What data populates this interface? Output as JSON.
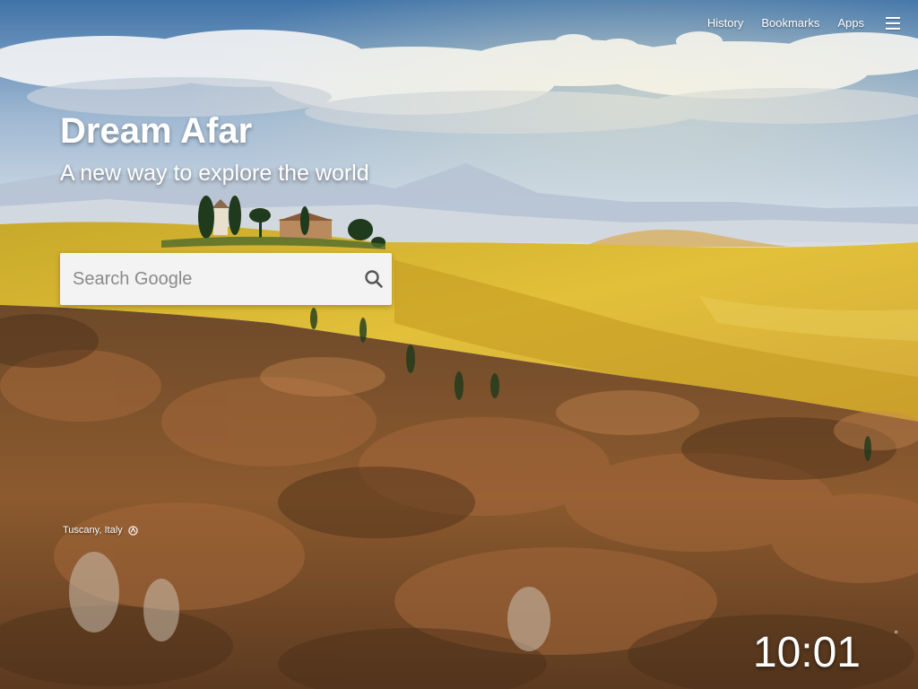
{
  "nav": {
    "history": "History",
    "bookmarks": "Bookmarks",
    "apps": "Apps",
    "menu_icon": "hamburger-menu-icon"
  },
  "brand": {
    "title": "Dream Afar",
    "subtitle": "A new way to explore the world"
  },
  "search": {
    "placeholder": "Search Google",
    "value": "",
    "icon": "search-icon"
  },
  "photo": {
    "location": "Tuscany, Italy",
    "location_icon": "location-info-icon"
  },
  "clock": {
    "time": "10:01",
    "degree": "°"
  },
  "colors": {
    "sky": "#4a78a8",
    "field": "#d8b42c",
    "forest": "#8a5a2c"
  }
}
